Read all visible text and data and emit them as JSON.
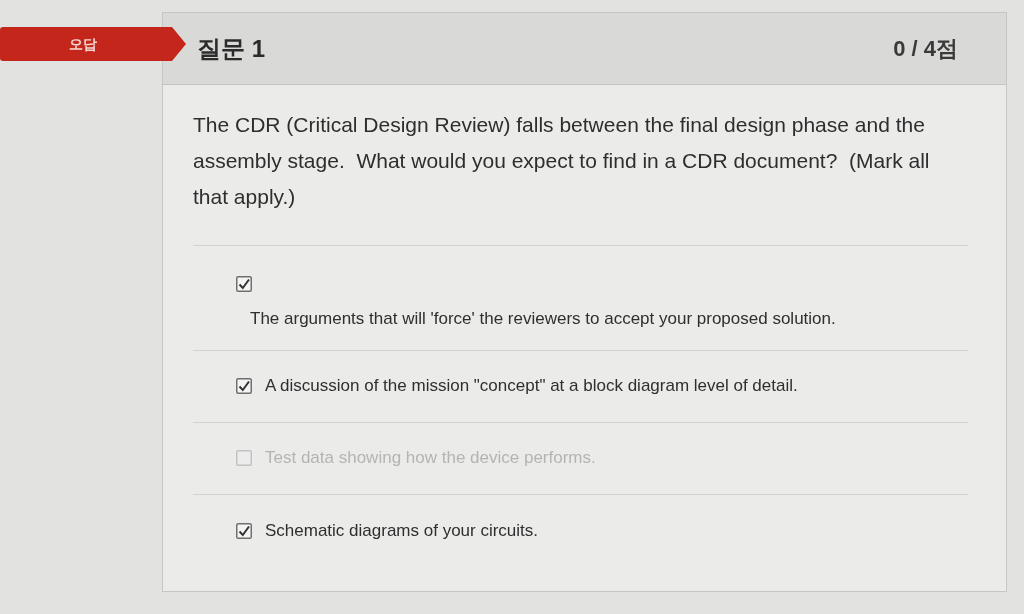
{
  "result_badge": {
    "label": "오답"
  },
  "question": {
    "title": "질문 1",
    "score": "0 / 4점",
    "text": "The CDR (Critical Design Review) falls between the final design phase and the assembly stage.  What would you expect to find in a CDR document?  (Mark all that apply.)"
  },
  "answers": [
    {
      "kind": "stacked",
      "checked": true,
      "text": "The arguments that will 'force' the reviewers to accept your proposed solution."
    },
    {
      "kind": "inline",
      "checked": true,
      "text": "A discussion of the mission \"concept\" at a block diagram level of detail."
    },
    {
      "kind": "inline",
      "checked": false,
      "text": "Test data showing how the device performs."
    },
    {
      "kind": "inline",
      "checked": true,
      "text": "Schematic diagrams of your circuits."
    }
  ]
}
